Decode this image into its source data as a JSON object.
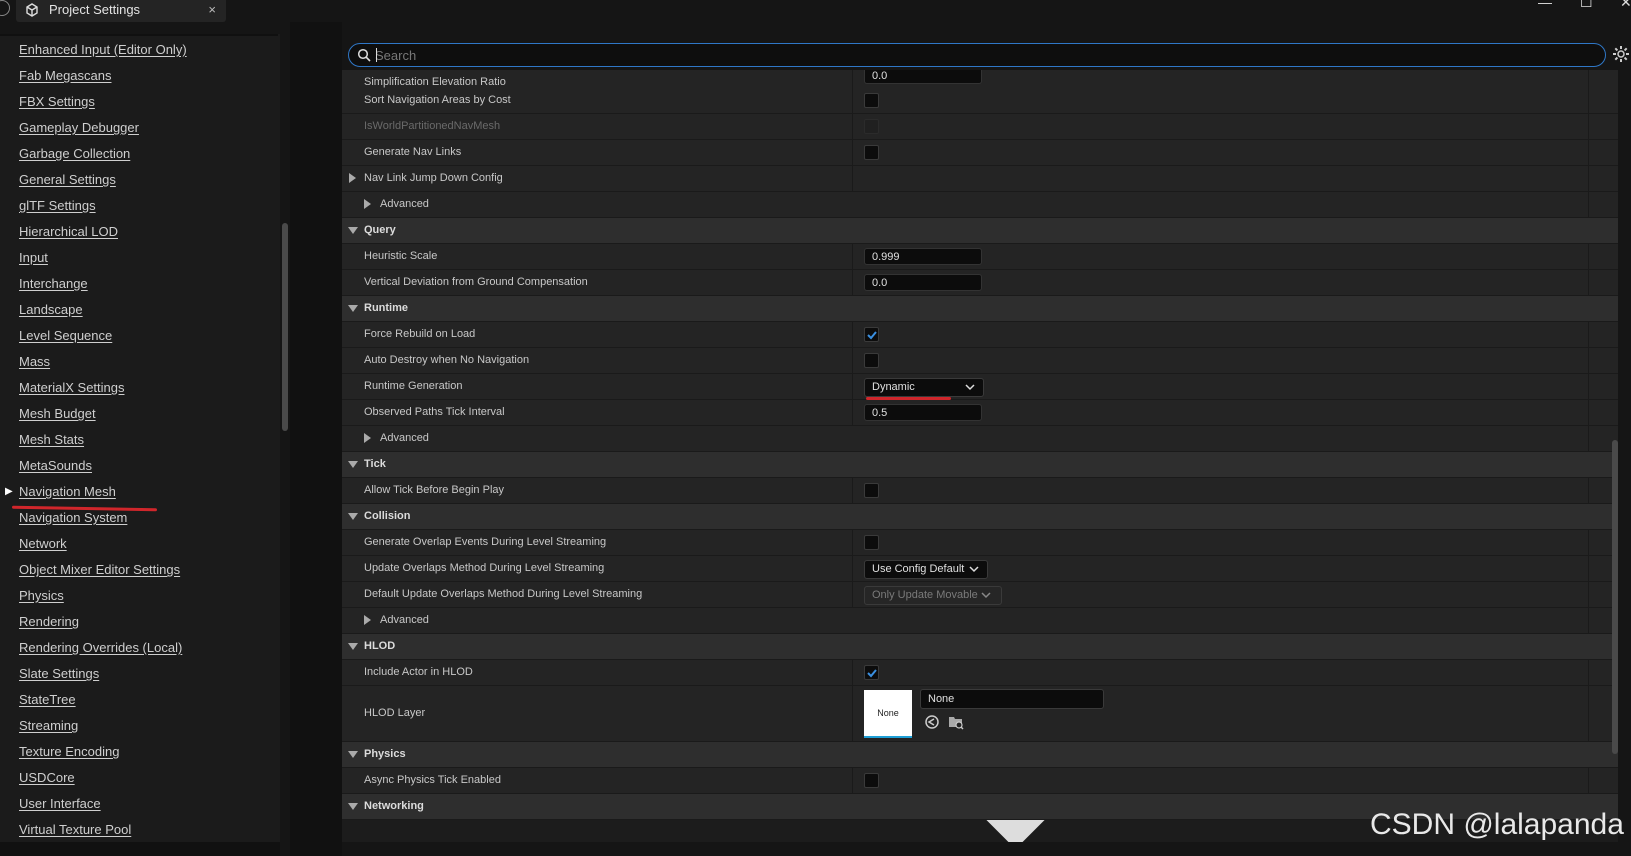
{
  "window": {
    "tab_title": "Project Settings",
    "tab_close": "×",
    "minimize": "—",
    "maximize": "☐",
    "close": "✕"
  },
  "sidebar": {
    "items": [
      {
        "label": "Enhanced Input (Editor Only)"
      },
      {
        "label": "Fab Megascans"
      },
      {
        "label": "FBX Settings"
      },
      {
        "label": "Gameplay Debugger"
      },
      {
        "label": "Garbage Collection"
      },
      {
        "label": "General Settings"
      },
      {
        "label": "glTF Settings"
      },
      {
        "label": "Hierarchical LOD"
      },
      {
        "label": "Input"
      },
      {
        "label": "Interchange"
      },
      {
        "label": "Landscape"
      },
      {
        "label": "Level Sequence"
      },
      {
        "label": "Mass"
      },
      {
        "label": "MaterialX Settings"
      },
      {
        "label": "Mesh Budget"
      },
      {
        "label": "Mesh Stats"
      },
      {
        "label": "MetaSounds"
      },
      {
        "label": "Navigation Mesh",
        "selected": true
      },
      {
        "label": "Navigation System"
      },
      {
        "label": "Network"
      },
      {
        "label": "Object Mixer Editor Settings"
      },
      {
        "label": "Physics"
      },
      {
        "label": "Rendering"
      },
      {
        "label": "Rendering Overrides (Local)"
      },
      {
        "label": "Slate Settings"
      },
      {
        "label": "StateTree"
      },
      {
        "label": "Streaming"
      },
      {
        "label": "Texture Encoding"
      },
      {
        "label": "USDCore"
      },
      {
        "label": "User Interface"
      },
      {
        "label": "Virtual Texture Pool"
      }
    ]
  },
  "search": {
    "placeholder": "Search",
    "value": ""
  },
  "details": {
    "simplification_elevation_ratio": {
      "label": "Simplification Elevation Ratio",
      "value": "0.0"
    },
    "sort_nav_areas": {
      "label": "Sort Navigation Areas by Cost",
      "checked": false
    },
    "is_world_partitioned": {
      "label": "IsWorldPartitionedNavMesh",
      "checked": false
    },
    "generate_nav_links": {
      "label": "Generate Nav Links",
      "checked": false
    },
    "nav_link_jump_down": {
      "label": "Nav Link Jump Down Config"
    },
    "advanced_1": {
      "label": "Advanced"
    },
    "query": {
      "label": "Query"
    },
    "heuristic_scale": {
      "label": "Heuristic Scale",
      "value": "0.999"
    },
    "vertical_deviation": {
      "label": "Vertical Deviation from Ground Compensation",
      "value": "0.0"
    },
    "runtime": {
      "label": "Runtime"
    },
    "force_rebuild": {
      "label": "Force Rebuild on Load",
      "checked": true
    },
    "auto_destroy": {
      "label": "Auto Destroy when No Navigation",
      "checked": false
    },
    "runtime_generation": {
      "label": "Runtime Generation",
      "value": "Dynamic"
    },
    "observed_paths": {
      "label": "Observed Paths Tick Interval",
      "value": "0.5"
    },
    "advanced_2": {
      "label": "Advanced"
    },
    "tick": {
      "label": "Tick"
    },
    "allow_tick": {
      "label": "Allow Tick Before Begin Play",
      "checked": false
    },
    "collision": {
      "label": "Collision"
    },
    "generate_overlap": {
      "label": "Generate Overlap Events During Level Streaming",
      "checked": false
    },
    "update_overlaps": {
      "label": "Update Overlaps Method During Level Streaming",
      "value": "Use Config Default"
    },
    "default_update_overlaps": {
      "label": "Default Update Overlaps Method During Level Streaming",
      "value": "Only Update Movable"
    },
    "advanced_3": {
      "label": "Advanced"
    },
    "hlod": {
      "label": "HLOD"
    },
    "include_actor_hlod": {
      "label": "Include Actor in HLOD",
      "checked": true
    },
    "hlod_layer": {
      "label": "HLOD Layer",
      "thumb": "None",
      "value": "None"
    },
    "physics": {
      "label": "Physics"
    },
    "async_physics": {
      "label": "Async Physics Tick Enabled",
      "checked": false
    },
    "networking": {
      "label": "Networking"
    }
  },
  "colors": {
    "accent": "#2f77c7",
    "check": "#3a8fe0",
    "annotation": "#d0262b"
  },
  "watermark": "CSDN @lalapanda"
}
